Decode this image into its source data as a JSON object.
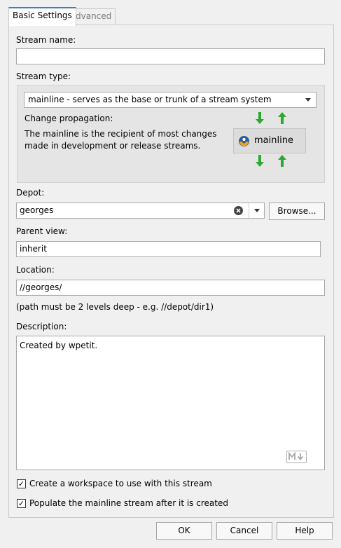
{
  "tabs": [
    {
      "label": "Basic Settings",
      "active": true
    },
    {
      "label": "Advanced",
      "active": false
    }
  ],
  "stream_name": {
    "label": "Stream name:",
    "value": ""
  },
  "stream_type": {
    "label": "Stream type:",
    "selected": "mainline - serves as the base or trunk of a stream system",
    "propagation_label": "Change propagation:",
    "description": "The mainline is the recipient of most changes made in development or release streams.",
    "diagram_label": "mainline"
  },
  "depot": {
    "label": "Depot:",
    "value": "georges",
    "browse_label": "Browse..."
  },
  "parent_view": {
    "label": "Parent view:",
    "value": "inherit"
  },
  "location": {
    "label": "Location:",
    "value": "//georges/",
    "hint": "(path must be 2 levels deep - e.g. //depot/dir1)"
  },
  "description": {
    "label": "Description:",
    "value": "Created by wpetit."
  },
  "checkboxes": [
    {
      "label": "Create a workspace to use with this stream",
      "checked": true
    },
    {
      "label": "Populate the mainline stream after it is created",
      "checked": true
    }
  ],
  "buttons": {
    "ok": "OK",
    "cancel": "Cancel",
    "help": "Help"
  },
  "colors": {
    "arrow_green": "#2ea82e",
    "accent": "#3c7fb1"
  }
}
